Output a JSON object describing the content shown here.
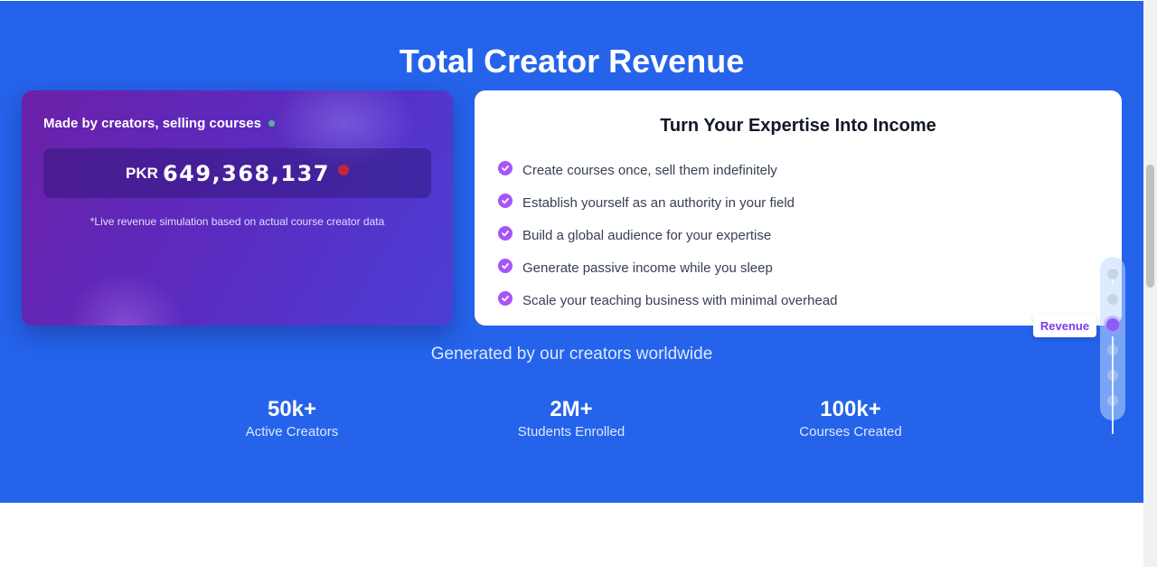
{
  "page": {
    "title": "Total Creator Revenue",
    "subtitle": "Generated by our creators worldwide"
  },
  "revenue_card": {
    "heading": "Made by creators, selling courses",
    "currency": "PKR",
    "amount": "649,368,137",
    "note": "*Live revenue simulation based on actual course creator data"
  },
  "info_card": {
    "title": "Turn Your Expertise Into Income",
    "items": [
      "Create courses once, sell them indefinitely",
      "Establish yourself as an authority in your field",
      "Build a global audience for your expertise",
      "Generate passive income while you sleep",
      "Scale your teaching business with minimal overhead"
    ]
  },
  "stats": [
    {
      "value": "50k+",
      "label": "Active Creators"
    },
    {
      "value": "2M+",
      "label": "Students Enrolled"
    },
    {
      "value": "100k+",
      "label": "Courses Created"
    }
  ],
  "section_nav": {
    "active_label": "Revenue"
  },
  "colors": {
    "background": "#2563eb",
    "accent": "#a855f7",
    "live_dot": "#dc2626"
  }
}
